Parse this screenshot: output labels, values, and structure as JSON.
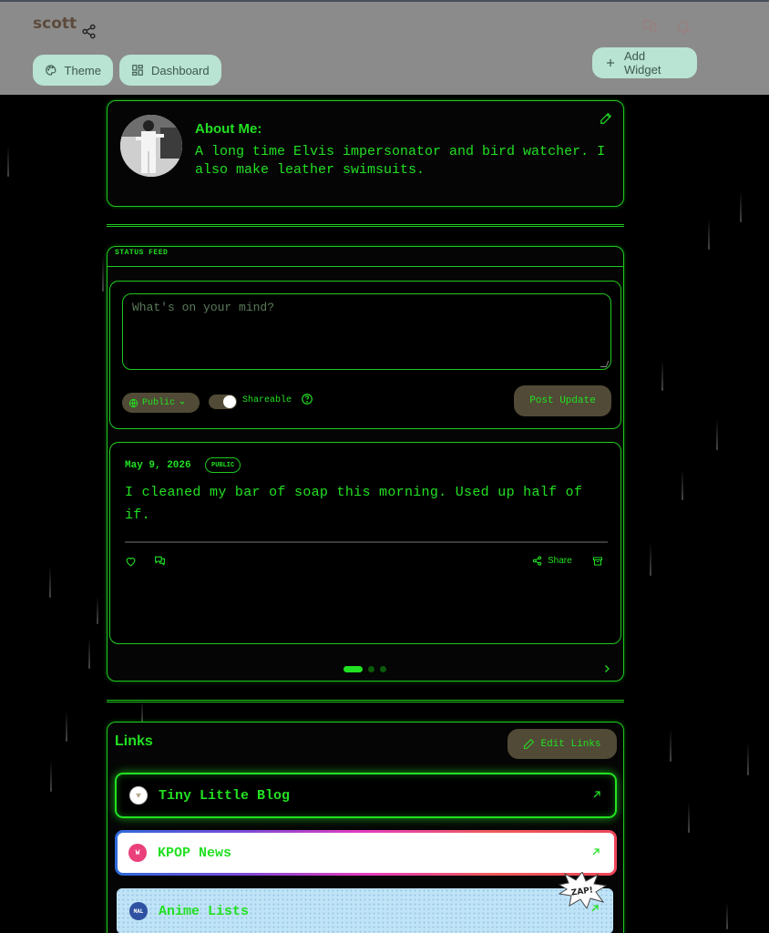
{
  "header": {
    "username": "scott",
    "buttons": {
      "theme": "Theme",
      "dashboard": "Dashboard",
      "add_widget": "Add Widget"
    }
  },
  "about": {
    "title": "About Me:",
    "text": "A long time Elvis impersonator and bird watcher. I also make leather swimsuits."
  },
  "feed": {
    "label": "STATUS FEED",
    "composer": {
      "placeholder": "What's on your mind?",
      "visibility": "Public",
      "toggle_label": "Shareable",
      "post_button": "Post Update"
    },
    "post": {
      "date": "May 9, 2026",
      "badge": "PUBLIC",
      "text": "I cleaned my bar of soap this morning. Used up half of if.",
      "share": "Share"
    },
    "pagination": {
      "total": 3,
      "active": 1
    }
  },
  "links": {
    "title": "Links",
    "edit_button": "Edit Links",
    "items": [
      {
        "label": "Tiny Little Blog"
      },
      {
        "label": "KPOP News",
        "icon_text": "W"
      },
      {
        "label": "Anime Lists",
        "icon_text": "MAL"
      }
    ],
    "sticker": "ZAP!"
  },
  "colors": {
    "accent": "#22e022",
    "header_bg": "#8b8b8b",
    "pill_bg": "#b9e3d2",
    "button_bg": "#514a36"
  }
}
